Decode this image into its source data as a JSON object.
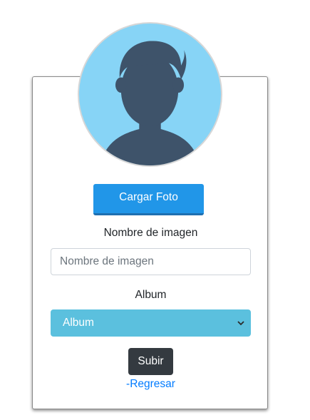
{
  "upload": {
    "label": "Cargar Foto"
  },
  "name": {
    "label": "Nombre de imagen",
    "placeholder": "Nombre de imagen",
    "value": ""
  },
  "album": {
    "label": "Album",
    "selected": "Album"
  },
  "submit": {
    "label": "Subir"
  },
  "back": {
    "label": "-Regresar"
  },
  "icons": {
    "avatar": "user-silhouette-icon",
    "select_chevron": "chevron-down-icon"
  },
  "colors": {
    "upload_button": "#2196e8",
    "album_select": "#5bc0de",
    "submit_button": "#343a40",
    "link": "#007bff",
    "avatar_background": "#87d4f6",
    "avatar_figure": "#3e536a"
  }
}
